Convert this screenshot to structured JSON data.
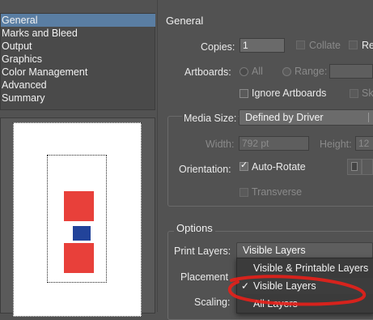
{
  "sidebar": {
    "items": [
      {
        "label": "General",
        "selected": true
      },
      {
        "label": "Marks and Bleed",
        "selected": false
      },
      {
        "label": "Output",
        "selected": false
      },
      {
        "label": "Graphics",
        "selected": false
      },
      {
        "label": "Color Management",
        "selected": false
      },
      {
        "label": "Advanced",
        "selected": false
      },
      {
        "label": "Summary",
        "selected": false
      }
    ]
  },
  "general": {
    "title": "General",
    "copies_label": "Copies:",
    "copies_value": "1",
    "collate_label": "Collate",
    "reverse_partial": "Re",
    "artboards_label": "Artboards:",
    "all_label": "All",
    "range_label": "Range:",
    "ignore_artboards_label": "Ignore Artboards",
    "skip_partial": "Sk"
  },
  "media": {
    "size_label": "Media Size:",
    "size_value": "Defined by Driver",
    "width_label": "Width:",
    "width_value": "792 pt",
    "height_label": "Height:",
    "height_value": "12",
    "orientation_label": "Orientation:",
    "auto_rotate_label": "Auto-Rotate",
    "transverse_label": "Transverse"
  },
  "options": {
    "title": "Options",
    "print_layers_label": "Print Layers:",
    "print_layers_value": "Visible Layers",
    "placement_label": "Placement",
    "scaling_label": "Scaling:"
  },
  "dropdown": {
    "items": [
      {
        "label": "Visible & Printable Layers",
        "checked": false
      },
      {
        "label": "Visible Layers",
        "checked": true
      },
      {
        "label": "All Layers",
        "checked": false
      }
    ]
  },
  "colors": {
    "selection": "#5a7ea3",
    "red_square": "#e8403a",
    "blue_square": "#22439a",
    "annotation": "#e8201a"
  }
}
